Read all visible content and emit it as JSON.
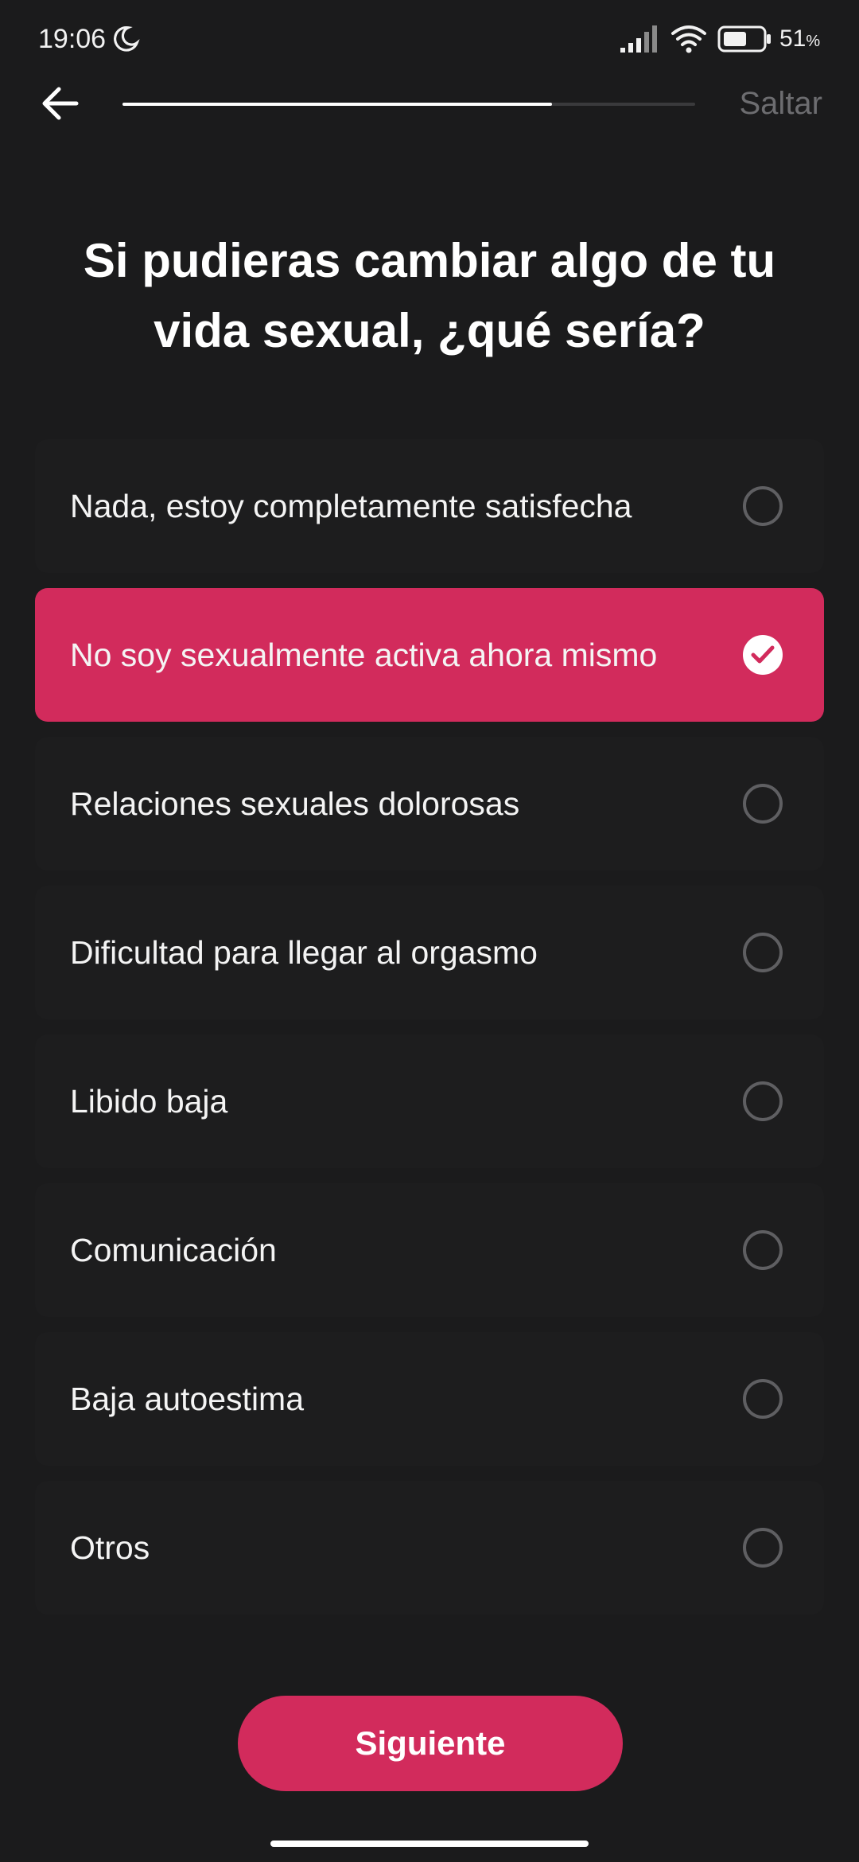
{
  "status_bar": {
    "time": "19:06",
    "battery": "51",
    "battery_unit": "%",
    "icons": [
      "moon-icon",
      "signal-icon",
      "wifi-icon",
      "battery-icon"
    ]
  },
  "nav": {
    "back_icon": "arrow-left-icon",
    "progress": 0.75,
    "skip_label": "Saltar"
  },
  "question": {
    "title": "Si pudieras cambiar algo de tu vida sexual, ¿qué sería?"
  },
  "options": [
    {
      "label": "Nada, estoy completamente satisfecha",
      "selected": false
    },
    {
      "label": "No soy sexualmente activa ahora mismo",
      "selected": true
    },
    {
      "label": "Relaciones sexuales dolorosas",
      "selected": false
    },
    {
      "label": "Dificultad para llegar al orgasmo",
      "selected": false
    },
    {
      "label": "Libido baja",
      "selected": false
    },
    {
      "label": "Comunicación",
      "selected": false
    },
    {
      "label": "Baja autoestima",
      "selected": false
    },
    {
      "label": "Otros",
      "selected": false
    }
  ],
  "next_button": {
    "label": "Siguiente"
  },
  "colors": {
    "background": "#1b1b1c",
    "accent": "#d22b5c",
    "muted_text": "#6d6d70"
  }
}
